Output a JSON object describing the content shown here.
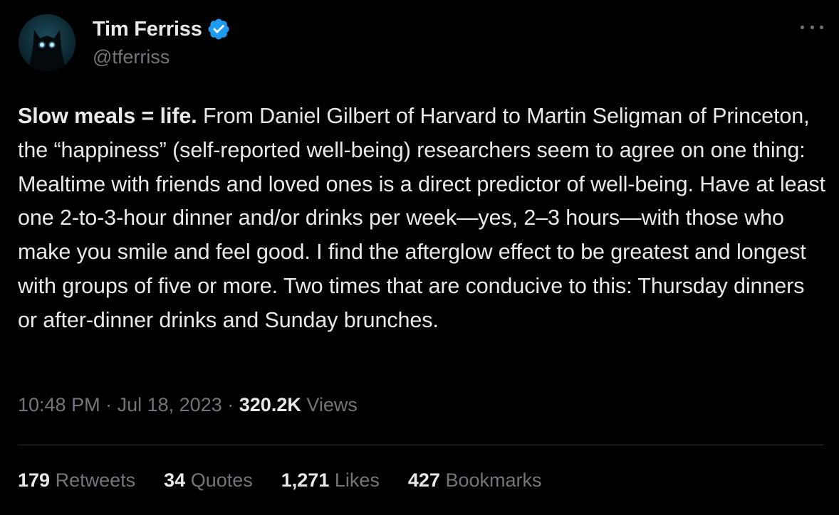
{
  "author": {
    "display_name": "Tim Ferriss",
    "handle": "@tferriss",
    "verified": true
  },
  "tweet": {
    "bold_lead": "Slow meals = life.",
    "text": " From Daniel Gilbert of Harvard to Martin Seligman of Princeton, the “happiness” (self-reported well-being) researchers seem to agree on one thing: Mealtime with friends and loved ones is a direct predictor of well-being. Have at least one 2-to-3-hour dinner and/or drinks per week—yes, 2–3 hours—with those who make you smile and feel good. I find the afterglow effect to be greatest and longest with groups of five or more. Two times that are conducive to this: Thursday dinners or after-dinner drinks and Sunday brunches."
  },
  "meta": {
    "time": "10:48 PM",
    "separator": "·",
    "date": "Jul 18, 2023",
    "views_count": "320.2K",
    "views_label": "Views"
  },
  "stats": {
    "retweets": {
      "count": "179",
      "label": "Retweets"
    },
    "quotes": {
      "count": "34",
      "label": "Quotes"
    },
    "likes": {
      "count": "1,271",
      "label": "Likes"
    },
    "bookmarks": {
      "count": "427",
      "label": "Bookmarks"
    }
  },
  "icons": {
    "verified": "verified-badge-icon",
    "more": "more-options-icon"
  },
  "colors": {
    "background": "#000000",
    "primary_text": "#e7e9ea",
    "secondary_text": "#71767b",
    "verified_blue": "#1d9bf0",
    "divider": "#2f3336"
  }
}
